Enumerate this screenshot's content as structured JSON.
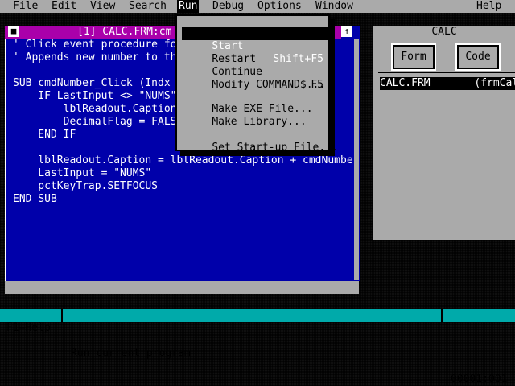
{
  "menubar": {
    "items": [
      "File",
      "Edit",
      "View",
      "Search",
      "Run",
      "Debug",
      "Options",
      "Window",
      "Help"
    ],
    "active": "Run"
  },
  "code_window": {
    "title": "[1] CALC.FRM:cm",
    "close_glyph": "■",
    "max_glyph": "↑",
    "lines": [
      "' Click event procedure fo",
      "' Appends new number to th",
      "",
      "SUB cmdNumber_Click (Indx",
      "    IF LastInput <> \"NUMS\"",
      "        lblReadout.Caption",
      "        DecimalFlag = FALS",
      "    END IF",
      "",
      "    lblReadout.Caption = lblReadout.Caption + cmdNumbe",
      "    LastInput = \"NUMS\"",
      "    pctKeyTrap.SETFOCUS",
      "END SUB"
    ]
  },
  "run_menu": {
    "items": [
      {
        "label": "Start",
        "accel": "Shift+F5"
      },
      {
        "label": "Restart",
        "accel": ""
      },
      {
        "label": "Continue",
        "accel": "F5"
      },
      {
        "label": "Modify COMMAND$...",
        "accel": ""
      },
      {
        "label": "Make EXE File...",
        "accel": ""
      },
      {
        "label": "Make Library...",
        "accel": ""
      },
      {
        "label": "Set Start-up File...",
        "accel": ""
      }
    ]
  },
  "project_window": {
    "title": "CALC",
    "form_button": "Form",
    "code_button": "Code",
    "row": "CALC.FRM       (frmCal"
  },
  "statusbar": {
    "help": "F1=Help",
    "message": "Run current program",
    "position": "00001:001"
  },
  "colors": {
    "code_bg": "#0000aa",
    "title_bg": "#aa00aa",
    "menu_bg": "#aaaaaa",
    "status_bg": "#00aaaa"
  }
}
